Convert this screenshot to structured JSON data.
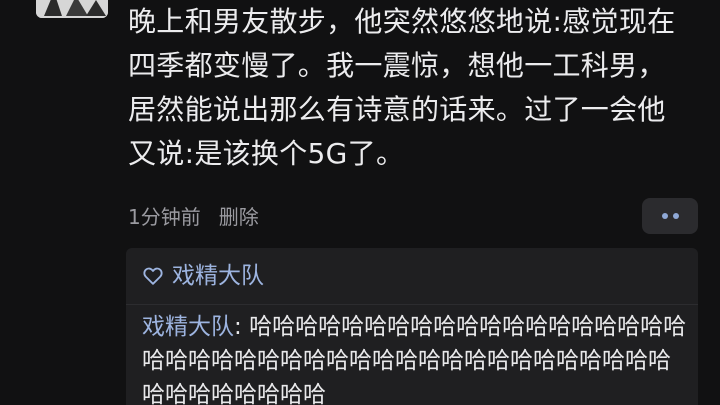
{
  "post": {
    "text": "晚上和男友散步，他突然悠悠地说:感觉现在四季都变慢了。我一震惊，想他一工科男，居然能说出那么有诗意的话来。过了一会他又说:是该换个5G了。",
    "time": "1分钟前",
    "delete_label": "删除",
    "more_icon": "more-dots-icon"
  },
  "interactions": {
    "like_icon": "heart-icon",
    "likes": "戏精大队",
    "comment": {
      "author": "戏精大队",
      "separator": ": ",
      "text": "哈哈哈哈哈哈哈哈哈哈哈哈哈哈哈哈哈哈哈哈哈哈哈哈哈哈哈哈哈哈哈哈哈哈哈哈哈哈哈哈哈哈哈哈哈哈哈哈哈哈"
    }
  },
  "colors": {
    "background": "#111112",
    "text": "#ececee",
    "meta": "#9a9aa0",
    "accent_name": "#9db4e0",
    "panel": "#1f1f21"
  }
}
